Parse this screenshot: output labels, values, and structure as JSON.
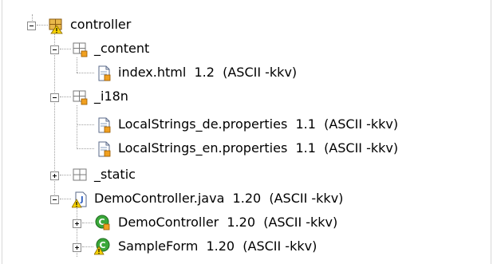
{
  "tree": {
    "nodes": [
      {
        "id": "controller",
        "label": "controller",
        "state": "expanded",
        "icon": "package-warning-icon"
      },
      {
        "id": "content",
        "label": "_content",
        "state": "expanded",
        "icon": "package-modified-icon"
      },
      {
        "id": "index",
        "label": "index.html  1.2  (ASCII -kkv)",
        "state": "leaf",
        "icon": "file-icon"
      },
      {
        "id": "i18n",
        "label": "_i18n",
        "state": "expanded",
        "icon": "package-modified-icon"
      },
      {
        "id": "ls_de",
        "label": "LocalStrings_de.properties  1.1  (ASCII -kkv)",
        "state": "leaf",
        "icon": "file-icon"
      },
      {
        "id": "ls_en",
        "label": "LocalStrings_en.properties  1.1  (ASCII -kkv)",
        "state": "leaf",
        "icon": "file-icon"
      },
      {
        "id": "static",
        "label": "_static",
        "state": "collapsed",
        "icon": "package-icon"
      },
      {
        "id": "democtrl_java",
        "label": "DemoController.java  1.20  (ASCII -kkv)",
        "state": "expanded",
        "icon": "java-file-warning-icon"
      },
      {
        "id": "democtrl_class",
        "label": "DemoController  1.20  (ASCII -kkv)",
        "state": "collapsed",
        "icon": "class-icon"
      },
      {
        "id": "sampleform",
        "label": "SampleForm  1.20  (ASCII -kkv)",
        "state": "collapsed",
        "icon": "class-warning-icon"
      }
    ]
  },
  "colors": {
    "package_fill": "#e8b84a",
    "package_stroke": "#8a5a10",
    "file_fill": "#ffffff",
    "file_stroke": "#5a6a8a",
    "badge_orange": "#f0a020",
    "warning_yellow": "#f6d200",
    "class_green": "#3aa83a",
    "java_blue": "#3060c0"
  }
}
